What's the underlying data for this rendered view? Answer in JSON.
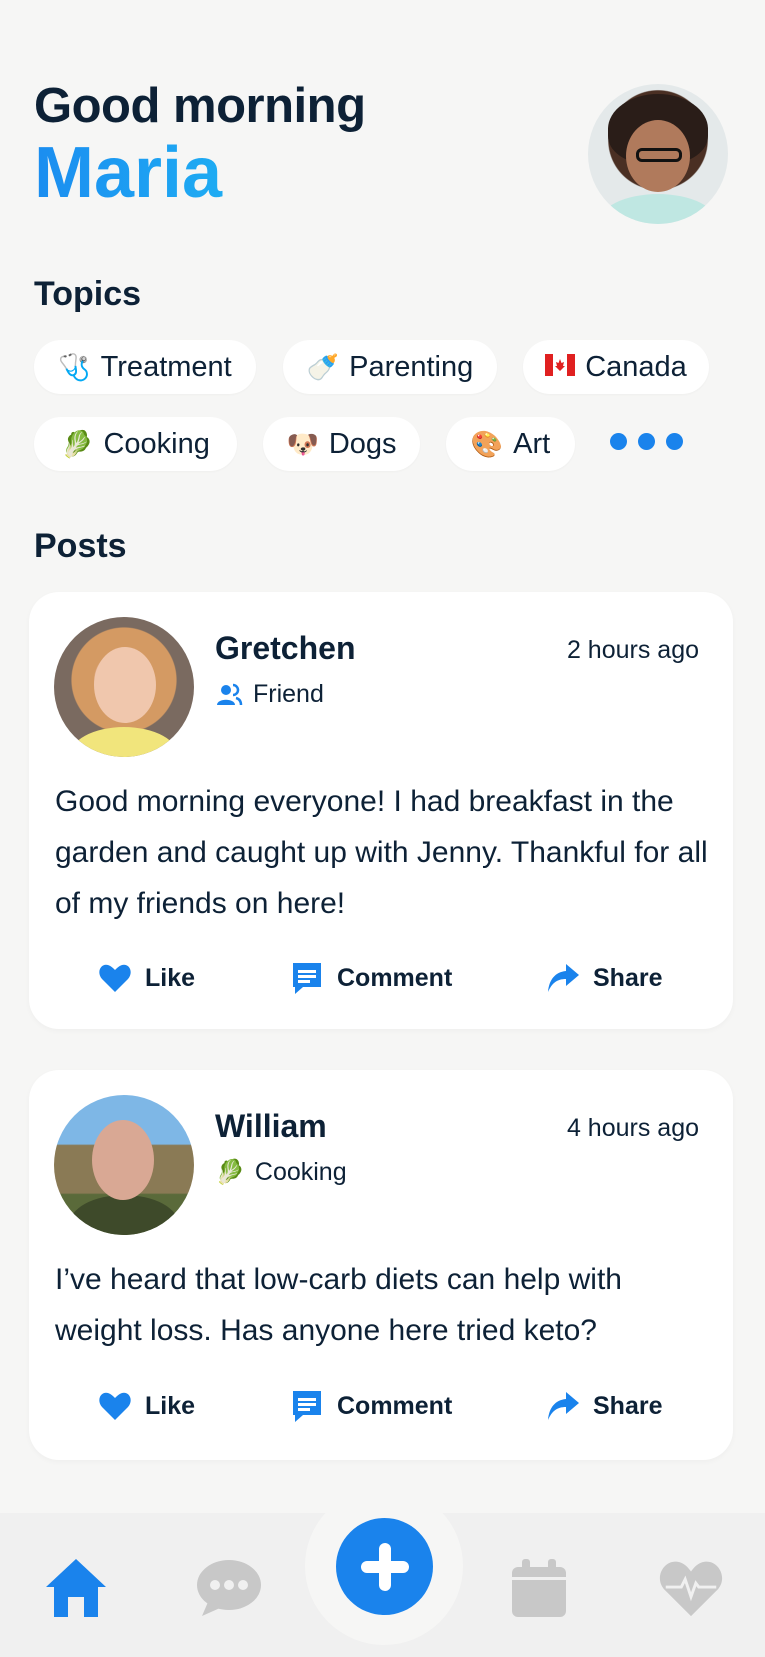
{
  "header": {
    "greeting": "Good morning",
    "user_name": "Maria"
  },
  "topics": {
    "title": "Topics",
    "items": [
      {
        "icon": "stethoscope-icon",
        "emoji": "🩺",
        "label": "Treatment"
      },
      {
        "icon": "baby-bottle-icon",
        "emoji": "🍼",
        "label": "Parenting"
      },
      {
        "icon": "canada-flag-icon",
        "emoji": "🍁",
        "label": "Canada"
      },
      {
        "icon": "leafy-green-icon",
        "emoji": "🥬",
        "label": "Cooking"
      },
      {
        "icon": "dog-face-icon",
        "emoji": "🐶",
        "label": "Dogs"
      },
      {
        "icon": "artist-palette-icon",
        "emoji": "🎨",
        "label": "Art"
      }
    ],
    "more_icon": "more-dots-icon"
  },
  "posts": {
    "title": "Posts",
    "items": [
      {
        "author": "Gretchen",
        "tag": "Friend",
        "tag_icon": "friend-icon",
        "time": "2 hours ago",
        "text": "Good morning everyone! I had breakfast in the garden and caught up with Jenny. Thankful for all of my friends on here!",
        "actions": {
          "like": "Like",
          "comment": "Comment",
          "share": "Share"
        }
      },
      {
        "author": "William",
        "tag": "Cooking",
        "tag_icon": "leafy-green-icon",
        "time": "4 hours ago",
        "text": "I’ve heard that low-carb diets can help with weight loss. Has anyone here tried keto?",
        "actions": {
          "like": "Like",
          "comment": "Comment",
          "share": "Share"
        }
      }
    ]
  },
  "tabbar": {
    "items": [
      "home-icon",
      "chat-icon",
      "add-icon",
      "calendar-icon",
      "health-heart-icon"
    ],
    "active": "home-icon"
  },
  "colors": {
    "accent": "#1a83ec",
    "text": "#0d2136",
    "background": "#f6f6f5",
    "inactive_icon": "#c8c8c8"
  }
}
